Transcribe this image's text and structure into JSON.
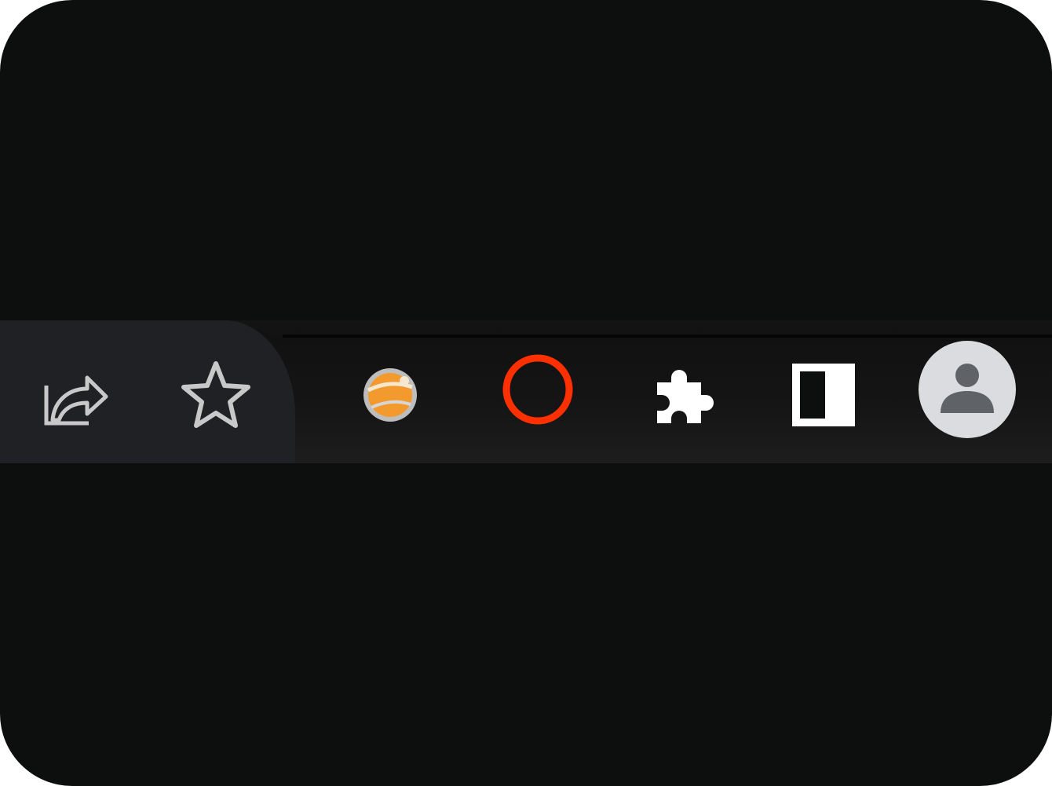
{
  "colors": {
    "page_background": "#0d0e0e",
    "address_bar": "#202124",
    "icon_gray": "#c8c8c8",
    "extension_orange": "#f29a2e",
    "extension_red_ring": "#ff3000",
    "profile_avatar_bg": "#dadce0",
    "profile_avatar_fg": "#5f6368",
    "white": "#ffffff"
  },
  "toolbar": {
    "icons": [
      {
        "name": "share-icon"
      },
      {
        "name": "bookmark-star-icon"
      },
      {
        "name": "honey-extension-icon"
      },
      {
        "name": "red-ring-extension-icon"
      },
      {
        "name": "extensions-puzzle-icon"
      },
      {
        "name": "side-panel-icon"
      },
      {
        "name": "profile-avatar-icon"
      }
    ]
  }
}
